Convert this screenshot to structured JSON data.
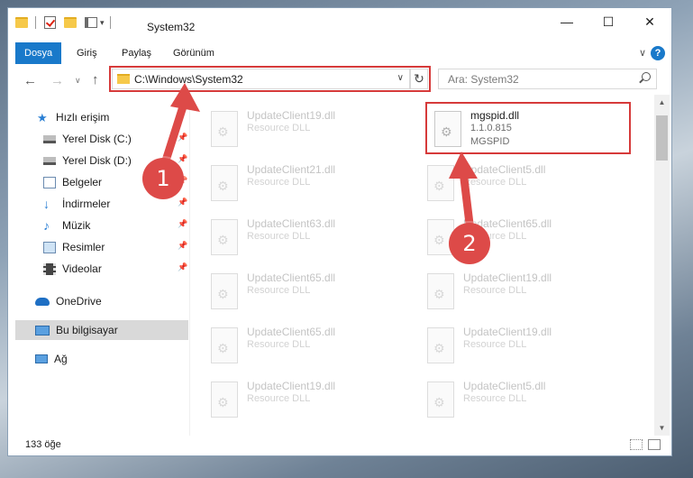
{
  "window": {
    "title": "System32",
    "minimize_glyph": "—",
    "maximize_glyph": "☐",
    "close_glyph": "✕"
  },
  "ribbon": {
    "tabs": [
      "Dosya",
      "Giriş",
      "Paylaş",
      "Görünüm"
    ],
    "expand_glyph": "∨",
    "help_glyph": "?"
  },
  "nav": {
    "back_glyph": "←",
    "forward_glyph": "→",
    "recent_glyph": "∨",
    "up_glyph": "↑"
  },
  "address": {
    "path": "C:\\Windows\\System32",
    "dropdown_glyph": "∨",
    "refresh_glyph": "↻"
  },
  "search": {
    "placeholder": "Ara: System32"
  },
  "sidebar": {
    "items": [
      {
        "label": "Hızlı erişim",
        "icon": "star-icon"
      },
      {
        "label": "Yerel Disk (C:)",
        "icon": "drive-icon"
      },
      {
        "label": "Yerel Disk (D:)",
        "icon": "drive-icon"
      },
      {
        "label": "Belgeler",
        "icon": "documents-icon"
      },
      {
        "label": "İndirmeler",
        "icon": "download-icon"
      },
      {
        "label": "Müzik",
        "icon": "music-icon"
      },
      {
        "label": "Resimler",
        "icon": "pictures-icon"
      },
      {
        "label": "Videolar",
        "icon": "video-icon"
      },
      {
        "label": "OneDrive",
        "icon": "cloud-icon"
      },
      {
        "label": "Bu bilgisayar",
        "icon": "computer-icon"
      },
      {
        "label": "Ağ",
        "icon": "network-icon"
      }
    ],
    "pin_glyph": "📌"
  },
  "files": {
    "main": {
      "name": "mgspid.dll",
      "version": "1.1.0.815",
      "description": "MGSPID"
    },
    "left_column": [
      {
        "name": "UpdateClient19.dll",
        "type": "Resource DLL"
      },
      {
        "name": "UpdateClient21.dll",
        "type": "Resource DLL"
      },
      {
        "name": "UpdateClient63.dll",
        "type": "Resource DLL"
      },
      {
        "name": "UpdateClient65.dll",
        "type": "Resource DLL"
      },
      {
        "name": "UpdateClient65.dll",
        "type": "Resource DLL"
      },
      {
        "name": "UpdateClient19.dll",
        "type": "Resource DLL"
      }
    ],
    "right_column": [
      {
        "name": "UpdateClient5.dll",
        "type": "Resource DLL"
      },
      {
        "name": "UpdateClient65.dll",
        "type": "Resource DLL"
      },
      {
        "name": "UpdateClient19.dll",
        "type": "Resource DLL"
      },
      {
        "name": "UpdateClient19.dll",
        "type": "Resource DLL"
      },
      {
        "name": "UpdateClient5.dll",
        "type": "Resource DLL"
      }
    ]
  },
  "scrollbar": {
    "up_glyph": "▲",
    "down_glyph": "▼"
  },
  "status": {
    "item_count": "133 öğe"
  },
  "annotations": {
    "step1": "1",
    "step2": "2",
    "highlight_color": "#d63a3a",
    "badge_color": "#dd4a48"
  },
  "colors": {
    "accent": "#1979ca",
    "folder": "#f6c94a"
  }
}
